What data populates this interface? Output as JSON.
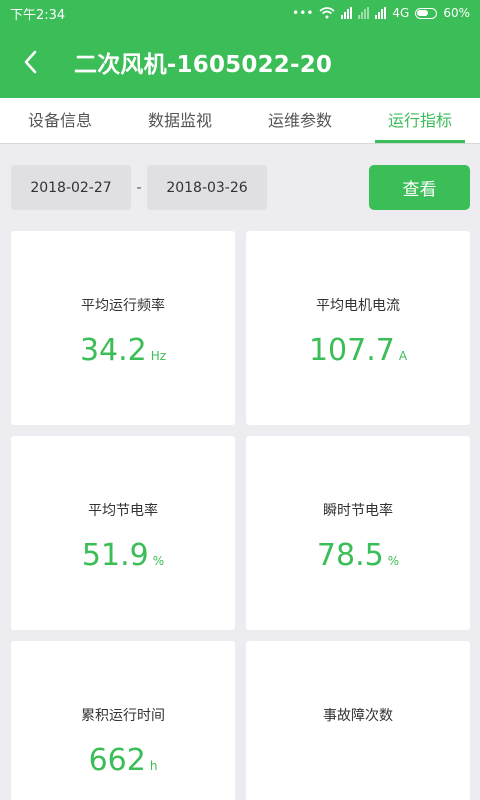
{
  "status": {
    "time": "下午2:34",
    "network": "4G",
    "battery": "60%"
  },
  "header": {
    "title": "二次风机-1605022-20"
  },
  "tabs": [
    {
      "label": "设备信息",
      "active": false
    },
    {
      "label": "数据监视",
      "active": false
    },
    {
      "label": "运维参数",
      "active": false
    },
    {
      "label": "运行指标",
      "active": true
    }
  ],
  "filter": {
    "start_date": "2018-02-27",
    "separator": "-",
    "end_date": "2018-03-26",
    "view_label": "查看"
  },
  "metrics": [
    {
      "label": "平均运行频率",
      "value": "34.2",
      "unit": "Hz"
    },
    {
      "label": "平均电机电流",
      "value": "107.7",
      "unit": "A"
    },
    {
      "label": "平均节电率",
      "value": "51.9",
      "unit": "%"
    },
    {
      "label": "瞬时节电率",
      "value": "78.5",
      "unit": "%"
    },
    {
      "label": "累积运行时间",
      "value": "662",
      "unit": "h"
    },
    {
      "label": "事故障次数",
      "value": "",
      "unit": ""
    }
  ],
  "colors": {
    "brand": "#3bbd57",
    "background": "#ededf1"
  }
}
